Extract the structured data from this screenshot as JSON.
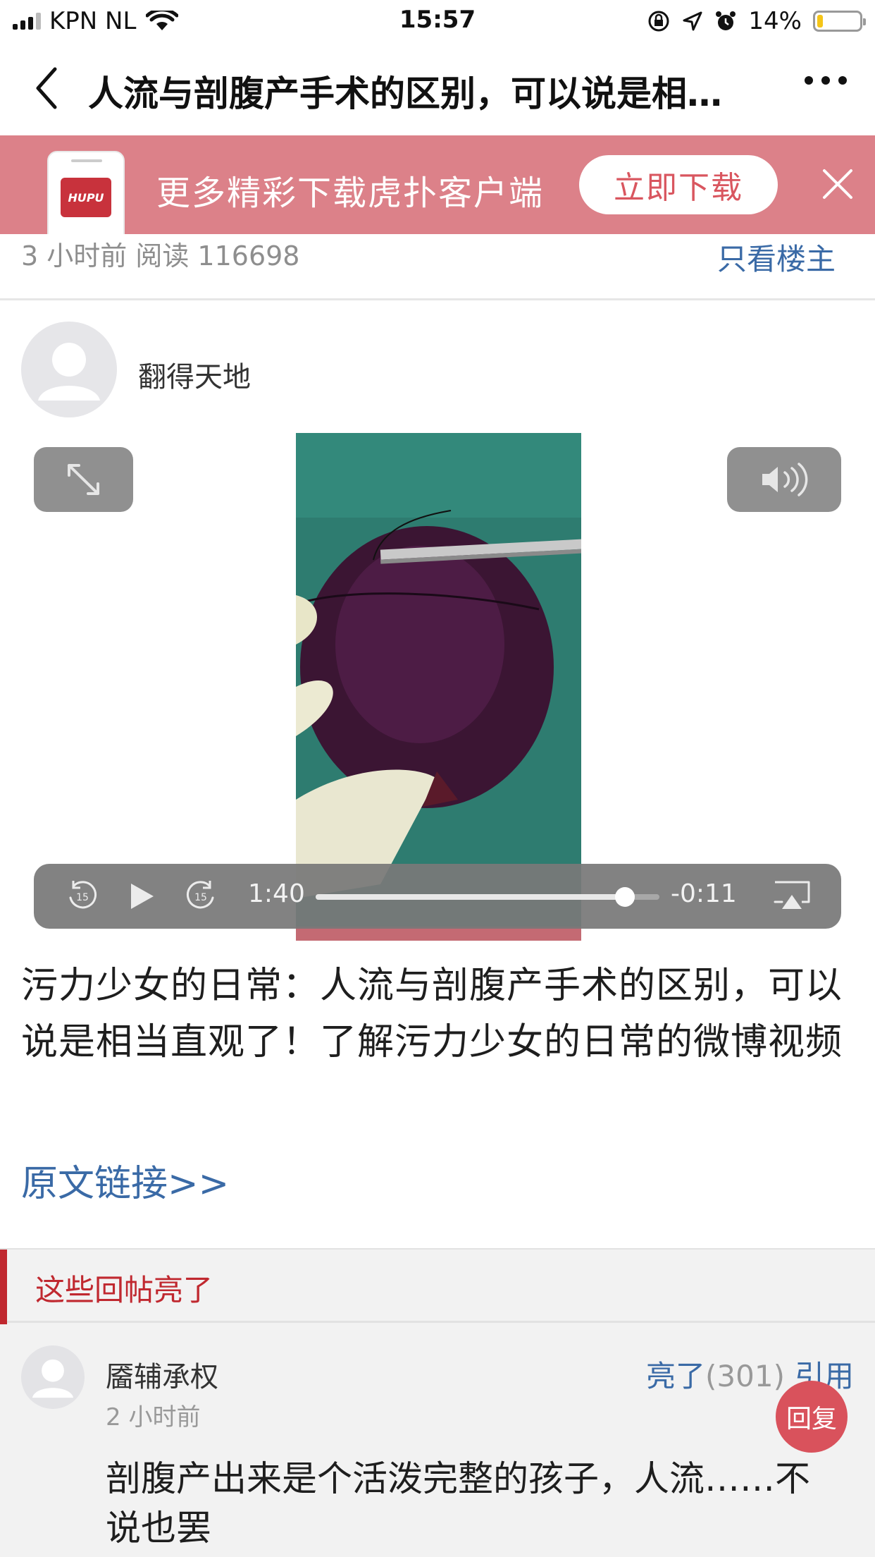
{
  "status_bar": {
    "carrier": "KPN NL",
    "time": "15:57",
    "battery_percent": "14%",
    "battery_level": 0.14,
    "battery_color": "#f5c518",
    "icons": [
      "signal-icon",
      "wifi-icon",
      "rotation-lock-icon",
      "location-icon",
      "alarm-icon",
      "battery-icon"
    ]
  },
  "nav": {
    "title": "人流与剖腹产手术的区别，可以说是相当直观了！了解污力少女的日常的微博视频"
  },
  "banner": {
    "app_logo": "HUPU",
    "text": "更多精彩下载虎扑客户端",
    "button_label": "立即下载",
    "background_color": "#dc8189"
  },
  "post": {
    "meta": "3 小时前  阅读 116698",
    "only_op_label": "只看楼主",
    "author": "翻得天地",
    "body": "污力少女的日常：人流与剖腹产手术的区别，可以说是相当直观了！了解污力少女的日常的微博视频",
    "link_label": "原文链接>>",
    "link_color": "#3a6aa6"
  },
  "video": {
    "elapsed": "1:40",
    "remaining": "-0:11",
    "progress": 0.9,
    "skip_back_label": "15",
    "skip_forward_label": "15"
  },
  "lit_replies": {
    "section_title": "这些回帖亮了",
    "accent_color": "#c0282f",
    "replies": [
      {
        "username": "靥辅承权",
        "time": "2 小时前",
        "lit_label": "亮了",
        "lit_count": "(301)",
        "quote_label": "引用",
        "text": "剖腹产出来是个活泼完整的孩子，人流……不说也罢"
      }
    ]
  },
  "reply_button_label": "回复"
}
